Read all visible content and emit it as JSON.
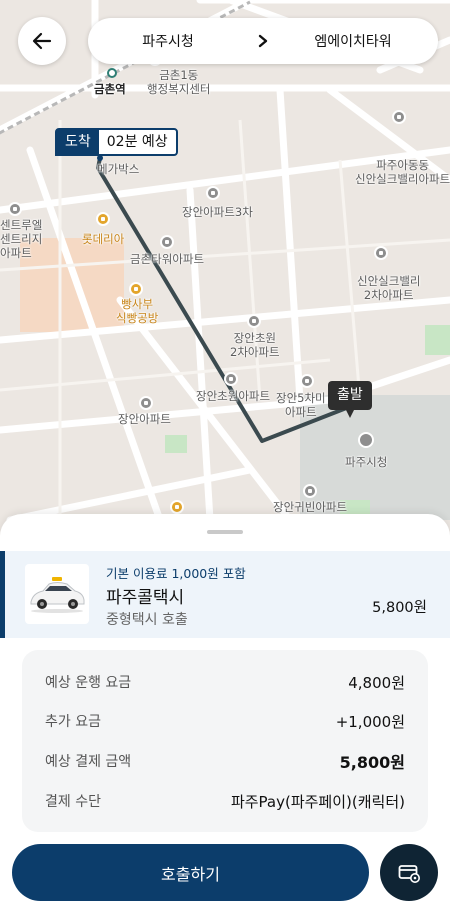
{
  "header": {
    "from": "파주시청",
    "to": "엠에이치타워"
  },
  "map": {
    "arrival_badge": {
      "tag": "도착",
      "eta": "02분 예상"
    },
    "departure_badge": "출발",
    "labels": {
      "station": "금촌역",
      "geumchon1dong": "금촌1동\n행정복지센터",
      "megabox": "메가박스",
      "paju_adong": "파주아동동\n신안실크밸리아파트",
      "centrul": "센트루엘\n센트리지\n아파트",
      "lotteria": "롯데리아",
      "jangan3": "장안아파트3차",
      "geumchon_tower": "금촌타워아파트",
      "sinan2": "신안실크밸리\n2차아파트",
      "bread": "빵사부\n식빵공방",
      "janganchowon2": "장안초원\n2차아파트",
      "janganchowon": "장안초원아파트",
      "jangan5": "장안5차미\n아파트",
      "jangan": "장안아파트",
      "city_hall": "파주시청",
      "jangan_gwibin": "장안귀빈아파트"
    }
  },
  "sheet": {
    "taxi": {
      "base_fee_note": "기본 이용료 1,000원 포함",
      "name": "파주콜택시",
      "sub": "중형택시 호출",
      "price": "5,800원"
    },
    "fare": {
      "rows": [
        {
          "label": "예상 운행 요금",
          "value": "4,800원"
        },
        {
          "label": "추가 요금",
          "value": "+1,000원"
        },
        {
          "label": "예상 결제 금액",
          "value": "5,800원"
        },
        {
          "label": "결제 수단",
          "value": "파주Pay(파주페이)(캐릭터)"
        }
      ]
    },
    "call_button": "호출하기"
  },
  "colors": {
    "primary": "#0c3d6b",
    "route": "#3b4a4f",
    "map_bg": "#ece7e2"
  }
}
